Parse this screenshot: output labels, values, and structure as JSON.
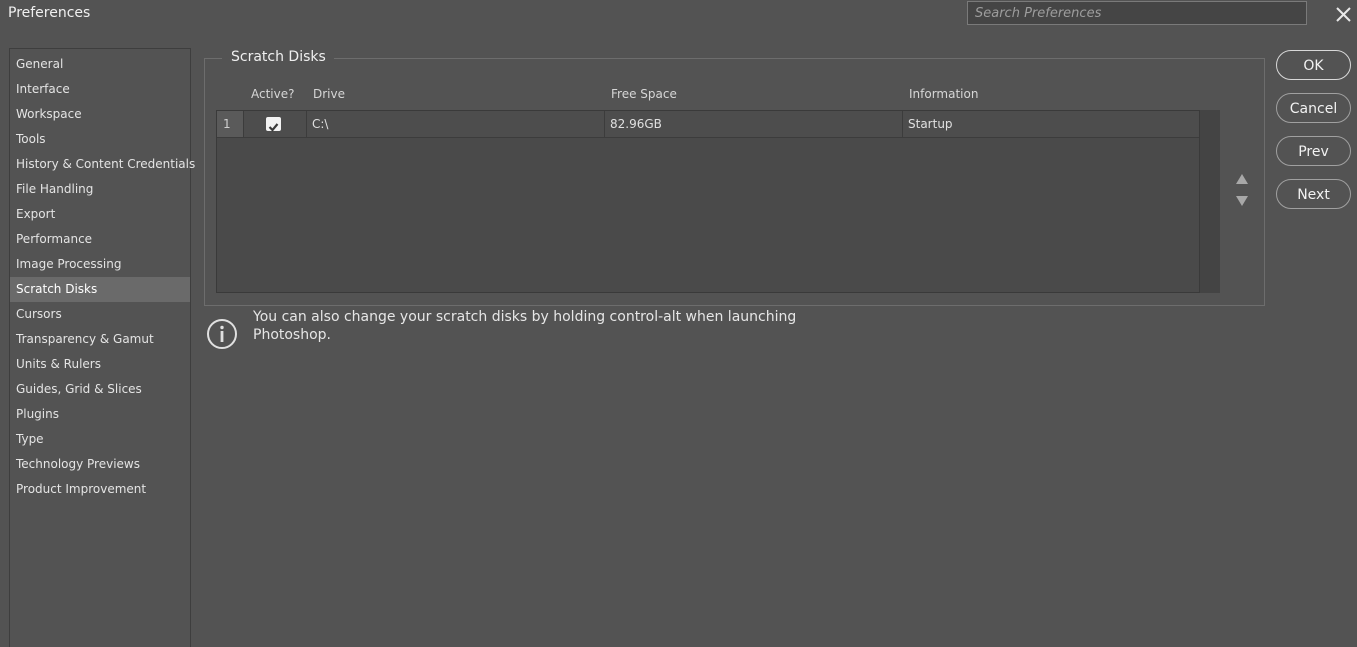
{
  "window": {
    "title": "Preferences"
  },
  "search": {
    "placeholder": "Search Preferences",
    "value": ""
  },
  "sidebar": {
    "selected": "Scratch Disks",
    "items": [
      {
        "label": "General"
      },
      {
        "label": "Interface"
      },
      {
        "label": "Workspace"
      },
      {
        "label": "Tools"
      },
      {
        "label": "History & Content Credentials"
      },
      {
        "label": "File Handling"
      },
      {
        "label": "Export"
      },
      {
        "label": "Performance"
      },
      {
        "label": "Image Processing"
      },
      {
        "label": "Scratch Disks"
      },
      {
        "label": "Cursors"
      },
      {
        "label": "Transparency & Gamut"
      },
      {
        "label": "Units & Rulers"
      },
      {
        "label": "Guides, Grid & Slices"
      },
      {
        "label": "Plugins"
      },
      {
        "label": "Type"
      },
      {
        "label": "Technology Previews"
      },
      {
        "label": "Product Improvement"
      }
    ]
  },
  "scratch_disks": {
    "title": "Scratch Disks",
    "columns": {
      "active": "Active?",
      "drive": "Drive",
      "free_space": "Free Space",
      "information": "Information"
    },
    "rows": [
      {
        "index": "1",
        "active": true,
        "drive": "C:\\",
        "free_space": "82.96GB",
        "information": "Startup"
      }
    ]
  },
  "info": {
    "text": "You can also change your scratch disks by holding control-alt when launching Photoshop."
  },
  "buttons": {
    "ok": "OK",
    "cancel": "Cancel",
    "prev": "Prev",
    "next": "Next"
  },
  "icons": {
    "close": "close-icon",
    "info": "info-icon",
    "checkmark": "checkmark-icon",
    "move_up": "arrow-up-icon",
    "move_down": "arrow-down-icon"
  },
  "colors": {
    "background": "#535353",
    "selected_item": "#6a6a6a",
    "table_background": "#4a4a4a"
  }
}
